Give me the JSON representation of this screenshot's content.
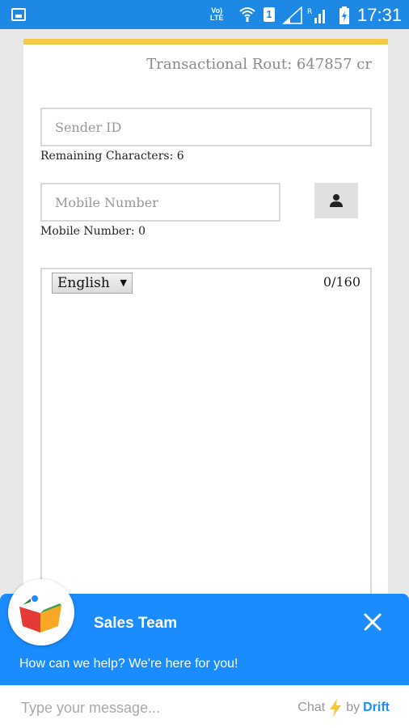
{
  "status_bar": {
    "volte_label": "Vo)\nLTE",
    "sim_label": "1",
    "time": "17:31"
  },
  "form": {
    "route_text": "Transactional Rout: 647857 cr",
    "sender_placeholder": "Sender ID",
    "remaining_label": "Remaining Characters: 6",
    "mobile_placeholder": "Mobile Number",
    "mobile_count_label": "Mobile Number: 0",
    "language_selected": "English",
    "char_counter": "0/160"
  },
  "chat": {
    "team_name": "Sales Team",
    "tagline": "How can we help? We're here for you!",
    "input_placeholder": "Type your message...",
    "powered_chat": "Chat",
    "powered_by": "by",
    "powered_brand": "Drift"
  },
  "colors": {
    "status_bar": "#1e88e5",
    "card_accent": "#f5c842",
    "chat_blue": "#1a8cff"
  }
}
